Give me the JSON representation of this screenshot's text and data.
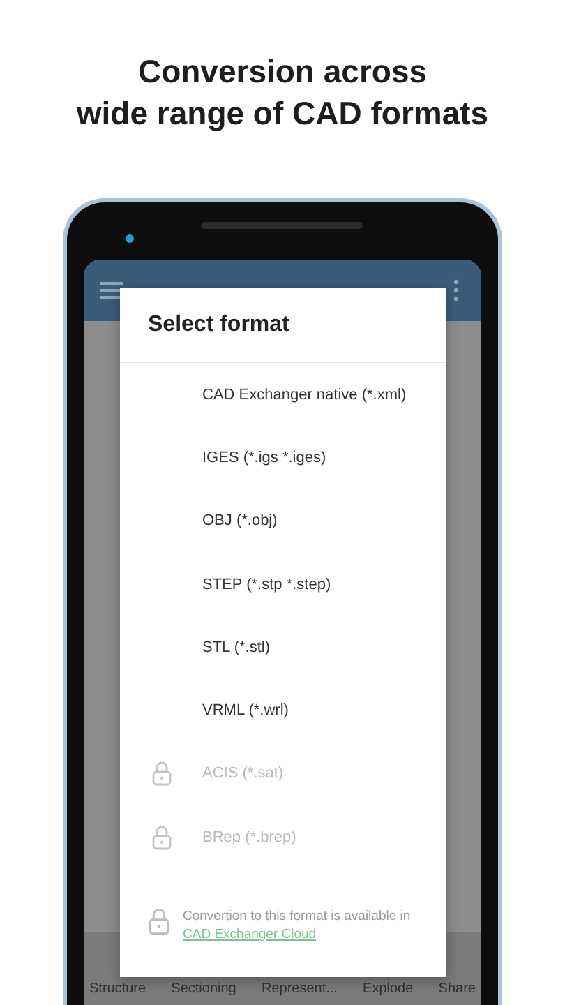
{
  "headline": [
    "Conversion across",
    "wide range of CAD formats"
  ],
  "dialog": {
    "title": "Select format",
    "formats": [
      {
        "label": "CAD Exchanger native (*.xml)",
        "locked": false
      },
      {
        "label": "IGES (*.igs *.iges)",
        "locked": false
      },
      {
        "label": "OBJ (*.obj)",
        "locked": false
      },
      {
        "label": "STEP (*.stp *.step)",
        "locked": false
      },
      {
        "label": "STL (*.stl)",
        "locked": false
      },
      {
        "label": "VRML (*.wrl)",
        "locked": false
      },
      {
        "label": "ACIS (*.sat)",
        "locked": true
      },
      {
        "label": "BRep (*.brep)",
        "locked": true
      }
    ],
    "note": {
      "text": "Convertion to this format is available in",
      "link": "CAD Exchanger Cloud"
    }
  },
  "bottom_nav": [
    {
      "label": "Structure"
    },
    {
      "label": "Sectioning"
    },
    {
      "label": "Represent..."
    },
    {
      "label": "Explode"
    },
    {
      "label": "Share"
    }
  ]
}
